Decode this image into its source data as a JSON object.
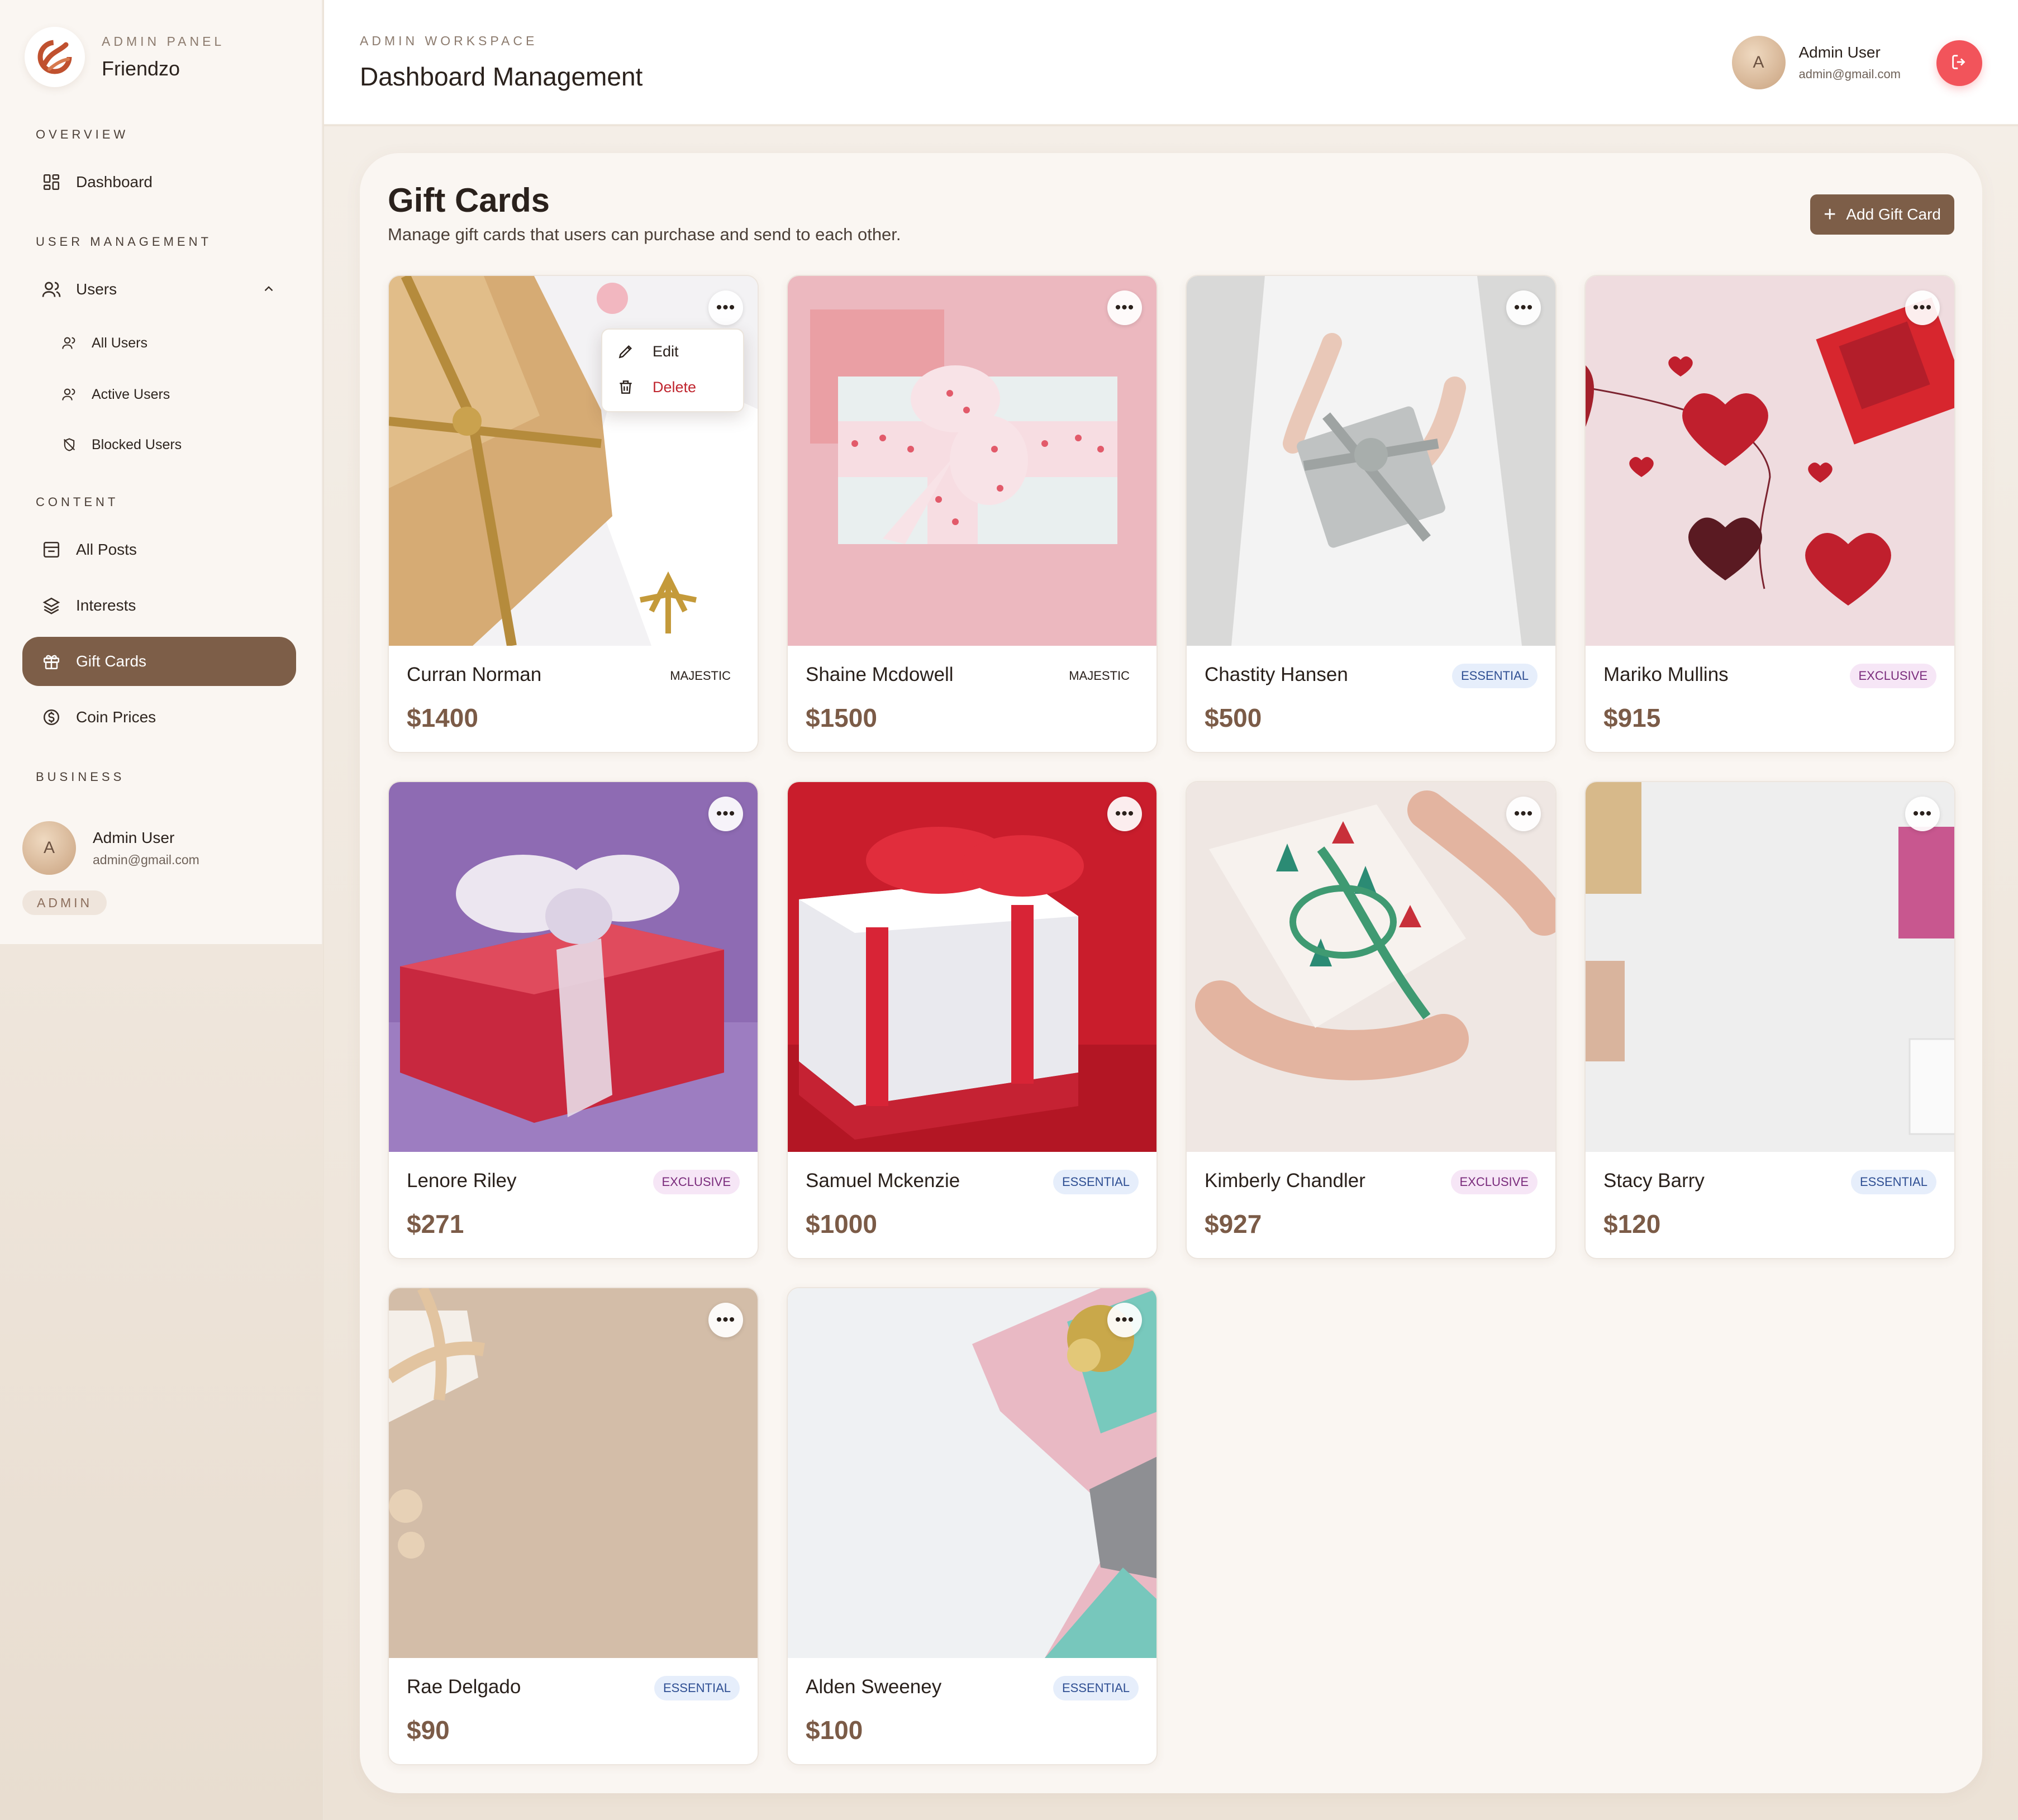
{
  "brand": {
    "kicker": "ADMIN PANEL",
    "name": "Friendzo"
  },
  "sidebar": {
    "sections": {
      "overview": "OVERVIEW",
      "user_management": "USER MANAGEMENT",
      "content": "CONTENT",
      "business": "BUSINESS"
    },
    "items": {
      "dashboard": "Dashboard",
      "users": "Users",
      "all_users": "All Users",
      "active_users": "Active Users",
      "blocked_users": "Blocked Users",
      "all_posts": "All Posts",
      "interests": "Interests",
      "gift_cards": "Gift Cards",
      "coin_prices": "Coin Prices"
    },
    "active": "gift_cards",
    "user": {
      "initial": "A",
      "name": "Admin User",
      "email": "admin@gmail.com",
      "role": "ADMIN"
    }
  },
  "header": {
    "kicker": "ADMIN WORKSPACE",
    "title": "Dashboard Management",
    "user": {
      "initial": "A",
      "name": "Admin User",
      "email": "admin@gmail.com"
    }
  },
  "main": {
    "title": "Gift Cards",
    "subtitle": "Manage gift cards that users can purchase and send to each other.",
    "add_button": "Add Gift Card",
    "menu": {
      "edit": "Edit",
      "delete": "Delete"
    },
    "cards": [
      {
        "name": "Curran Norman",
        "tier": "MAJESTIC",
        "price": "$1400"
      },
      {
        "name": "Shaine Mcdowell",
        "tier": "MAJESTIC",
        "price": "$1500"
      },
      {
        "name": "Chastity Hansen",
        "tier": "ESSENTIAL",
        "price": "$500"
      },
      {
        "name": "Mariko Mullins",
        "tier": "EXCLUSIVE",
        "price": "$915"
      },
      {
        "name": "Lenore Riley",
        "tier": "EXCLUSIVE",
        "price": "$271"
      },
      {
        "name": "Samuel Mckenzie",
        "tier": "ESSENTIAL",
        "price": "$1000"
      },
      {
        "name": "Kimberly Chandler",
        "tier": "EXCLUSIVE",
        "price": "$927"
      },
      {
        "name": "Stacy Barry",
        "tier": "ESSENTIAL",
        "price": "$120"
      },
      {
        "name": "Rae Delgado",
        "tier": "ESSENTIAL",
        "price": "$90"
      },
      {
        "name": "Alden Sweeney",
        "tier": "ESSENTIAL",
        "price": "$100"
      }
    ]
  },
  "colors": {
    "accent": "#7d5e48",
    "logout": "#f2545b",
    "essential_bg": "#e6eefb",
    "exclusive_bg": "#f6e6f6"
  },
  "icons": {
    "logo": "friendzo-logo-icon",
    "logout": "logout-icon",
    "more": "more-horizontal-icon"
  }
}
